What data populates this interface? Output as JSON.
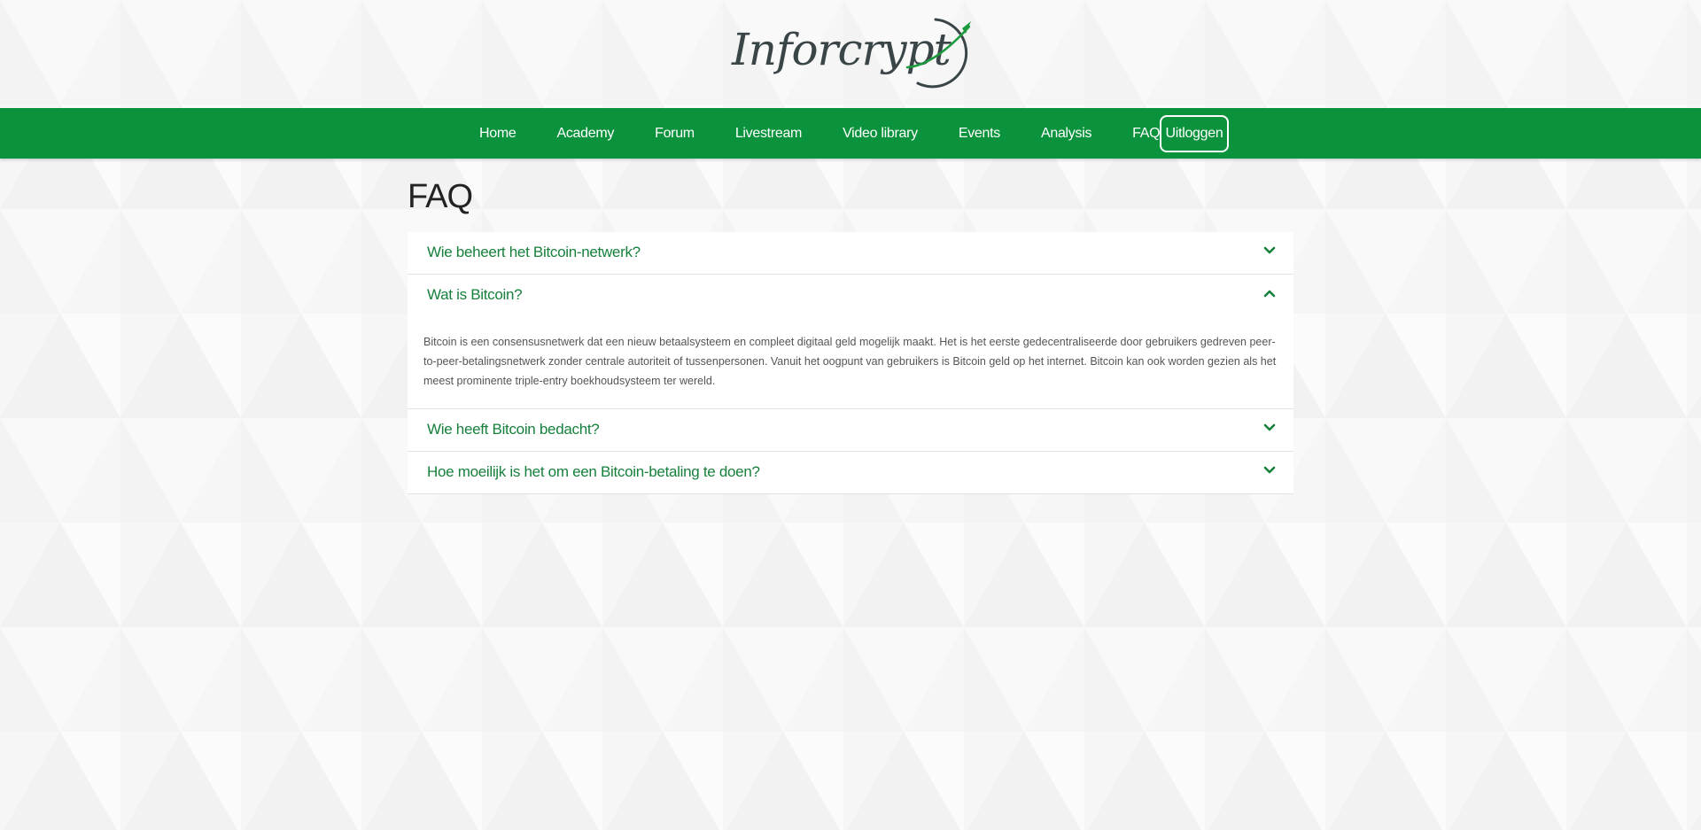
{
  "brand": {
    "logo_text": "Inforcrypt",
    "primary_color": "#0b923c",
    "link_color": "#16803c"
  },
  "nav": {
    "items": [
      {
        "label": "Home"
      },
      {
        "label": "Academy"
      },
      {
        "label": "Forum"
      },
      {
        "label": "Livestream"
      },
      {
        "label": "Video library"
      },
      {
        "label": "Events"
      },
      {
        "label": "Analysis"
      },
      {
        "label": "FAQ"
      }
    ],
    "logout_label": "Uitloggen"
  },
  "main": {
    "title": "FAQ",
    "faq": [
      {
        "question": "Wie beheert het Bitcoin-netwerk?",
        "expanded": false,
        "icon": "chevron-down-icon"
      },
      {
        "question": "Wat is Bitcoin?",
        "expanded": true,
        "icon": "chevron-up-icon",
        "answer": "Bitcoin is een consensusnetwerk dat een nieuw betaalsysteem en compleet digitaal geld mogelijk maakt. Het is het eerste gedecentraliseerde door gebruikers gedreven peer-to-peer-betalingsnetwerk zonder centrale autoriteit of tussenpersonen. Vanuit het oogpunt van gebruikers is Bitcoin geld op het internet. Bitcoin kan ook worden gezien als het meest prominente triple-entry boekhoudsysteem ter wereld."
      },
      {
        "question": "Wie heeft Bitcoin bedacht?",
        "expanded": false,
        "icon": "chevron-down-icon"
      },
      {
        "question": "Hoe moeilijk is het om een Bitcoin-betaling te doen?",
        "expanded": false,
        "icon": "chevron-down-icon"
      }
    ]
  }
}
